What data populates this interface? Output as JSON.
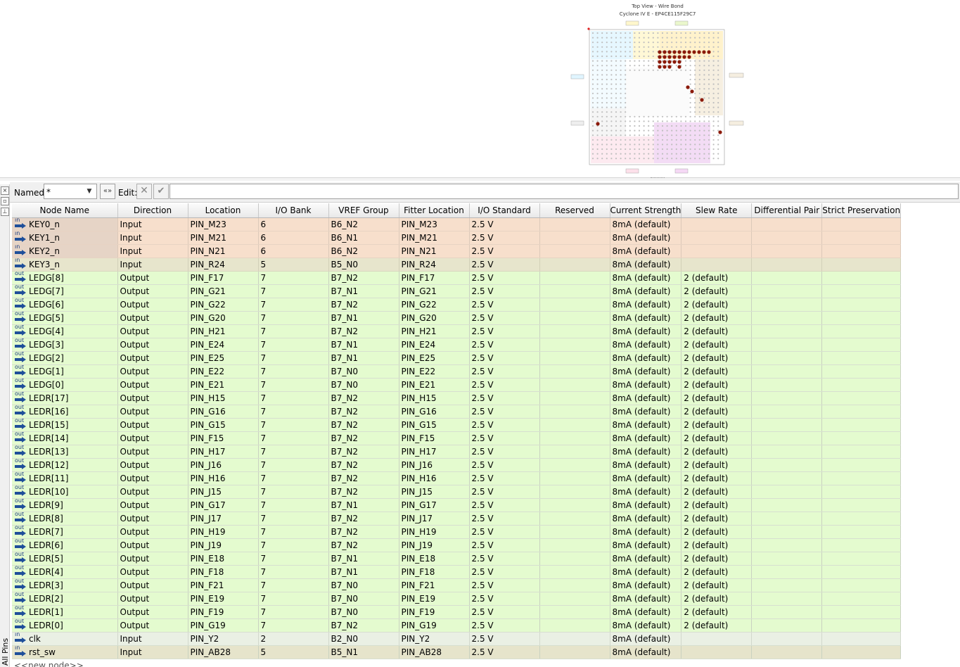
{
  "package_view": {
    "title": "Top View - Wire Bond",
    "device": "Cyclone IV E - EP4CE115F29C7"
  },
  "side_panel": {
    "label": "All Pins"
  },
  "filter": {
    "named_label": "Named:",
    "named_value": "*",
    "edit_label": "Edit:"
  },
  "columns": [
    "Node Name",
    "Direction",
    "Location",
    "I/O Bank",
    "VREF Group",
    "Fitter Location",
    "I/O Standard",
    "Reserved",
    "Current Strength",
    "Slew Rate",
    "Differential Pair",
    "Strict Preservation"
  ],
  "rows": [
    {
      "icon": "in",
      "name": "KEY0_n",
      "direction": "Input",
      "location": "PIN_M23",
      "bank": "6",
      "vref": "B6_N2",
      "fitter": "PIN_M23",
      "std": "2.5 V",
      "reserved": "",
      "current": "8mA (default)",
      "slew": "",
      "diff": "",
      "strict": ""
    },
    {
      "icon": "in",
      "name": "KEY1_n",
      "direction": "Input",
      "location": "PIN_M21",
      "bank": "6",
      "vref": "B6_N1",
      "fitter": "PIN_M21",
      "std": "2.5 V",
      "reserved": "",
      "current": "8mA (default)",
      "slew": "",
      "diff": "",
      "strict": ""
    },
    {
      "icon": "in",
      "name": "KEY2_n",
      "direction": "Input",
      "location": "PIN_N21",
      "bank": "6",
      "vref": "B6_N2",
      "fitter": "PIN_N21",
      "std": "2.5 V",
      "reserved": "",
      "current": "8mA (default)",
      "slew": "",
      "diff": "",
      "strict": ""
    },
    {
      "icon": "in",
      "name": "KEY3_n",
      "direction": "Input",
      "location": "PIN_R24",
      "bank": "5",
      "vref": "B5_N0",
      "fitter": "PIN_R24",
      "std": "2.5 V",
      "reserved": "",
      "current": "8mA (default)",
      "slew": "",
      "diff": "",
      "strict": ""
    },
    {
      "icon": "out",
      "name": "LEDG[8]",
      "direction": "Output",
      "location": "PIN_F17",
      "bank": "7",
      "vref": "B7_N2",
      "fitter": "PIN_F17",
      "std": "2.5 V",
      "reserved": "",
      "current": "8mA (default)",
      "slew": "2 (default)",
      "diff": "",
      "strict": ""
    },
    {
      "icon": "out",
      "name": "LEDG[7]",
      "direction": "Output",
      "location": "PIN_G21",
      "bank": "7",
      "vref": "B7_N1",
      "fitter": "PIN_G21",
      "std": "2.5 V",
      "reserved": "",
      "current": "8mA (default)",
      "slew": "2 (default)",
      "diff": "",
      "strict": ""
    },
    {
      "icon": "out",
      "name": "LEDG[6]",
      "direction": "Output",
      "location": "PIN_G22",
      "bank": "7",
      "vref": "B7_N2",
      "fitter": "PIN_G22",
      "std": "2.5 V",
      "reserved": "",
      "current": "8mA (default)",
      "slew": "2 (default)",
      "diff": "",
      "strict": ""
    },
    {
      "icon": "out",
      "name": "LEDG[5]",
      "direction": "Output",
      "location": "PIN_G20",
      "bank": "7",
      "vref": "B7_N1",
      "fitter": "PIN_G20",
      "std": "2.5 V",
      "reserved": "",
      "current": "8mA (default)",
      "slew": "2 (default)",
      "diff": "",
      "strict": ""
    },
    {
      "icon": "out",
      "name": "LEDG[4]",
      "direction": "Output",
      "location": "PIN_H21",
      "bank": "7",
      "vref": "B7_N2",
      "fitter": "PIN_H21",
      "std": "2.5 V",
      "reserved": "",
      "current": "8mA (default)",
      "slew": "2 (default)",
      "diff": "",
      "strict": ""
    },
    {
      "icon": "out",
      "name": "LEDG[3]",
      "direction": "Output",
      "location": "PIN_E24",
      "bank": "7",
      "vref": "B7_N1",
      "fitter": "PIN_E24",
      "std": "2.5 V",
      "reserved": "",
      "current": "8mA (default)",
      "slew": "2 (default)",
      "diff": "",
      "strict": ""
    },
    {
      "icon": "out",
      "name": "LEDG[2]",
      "direction": "Output",
      "location": "PIN_E25",
      "bank": "7",
      "vref": "B7_N1",
      "fitter": "PIN_E25",
      "std": "2.5 V",
      "reserved": "",
      "current": "8mA (default)",
      "slew": "2 (default)",
      "diff": "",
      "strict": ""
    },
    {
      "icon": "out",
      "name": "LEDG[1]",
      "direction": "Output",
      "location": "PIN_E22",
      "bank": "7",
      "vref": "B7_N0",
      "fitter": "PIN_E22",
      "std": "2.5 V",
      "reserved": "",
      "current": "8mA (default)",
      "slew": "2 (default)",
      "diff": "",
      "strict": ""
    },
    {
      "icon": "out",
      "name": "LEDG[0]",
      "direction": "Output",
      "location": "PIN_E21",
      "bank": "7",
      "vref": "B7_N0",
      "fitter": "PIN_E21",
      "std": "2.5 V",
      "reserved": "",
      "current": "8mA (default)",
      "slew": "2 (default)",
      "diff": "",
      "strict": ""
    },
    {
      "icon": "out",
      "name": "LEDR[17]",
      "direction": "Output",
      "location": "PIN_H15",
      "bank": "7",
      "vref": "B7_N2",
      "fitter": "PIN_H15",
      "std": "2.5 V",
      "reserved": "",
      "current": "8mA (default)",
      "slew": "2 (default)",
      "diff": "",
      "strict": ""
    },
    {
      "icon": "out",
      "name": "LEDR[16]",
      "direction": "Output",
      "location": "PIN_G16",
      "bank": "7",
      "vref": "B7_N2",
      "fitter": "PIN_G16",
      "std": "2.5 V",
      "reserved": "",
      "current": "8mA (default)",
      "slew": "2 (default)",
      "diff": "",
      "strict": ""
    },
    {
      "icon": "out",
      "name": "LEDR[15]",
      "direction": "Output",
      "location": "PIN_G15",
      "bank": "7",
      "vref": "B7_N2",
      "fitter": "PIN_G15",
      "std": "2.5 V",
      "reserved": "",
      "current": "8mA (default)",
      "slew": "2 (default)",
      "diff": "",
      "strict": ""
    },
    {
      "icon": "out",
      "name": "LEDR[14]",
      "direction": "Output",
      "location": "PIN_F15",
      "bank": "7",
      "vref": "B7_N2",
      "fitter": "PIN_F15",
      "std": "2.5 V",
      "reserved": "",
      "current": "8mA (default)",
      "slew": "2 (default)",
      "diff": "",
      "strict": ""
    },
    {
      "icon": "out",
      "name": "LEDR[13]",
      "direction": "Output",
      "location": "PIN_H17",
      "bank": "7",
      "vref": "B7_N2",
      "fitter": "PIN_H17",
      "std": "2.5 V",
      "reserved": "",
      "current": "8mA (default)",
      "slew": "2 (default)",
      "diff": "",
      "strict": ""
    },
    {
      "icon": "out",
      "name": "LEDR[12]",
      "direction": "Output",
      "location": "PIN_J16",
      "bank": "7",
      "vref": "B7_N2",
      "fitter": "PIN_J16",
      "std": "2.5 V",
      "reserved": "",
      "current": "8mA (default)",
      "slew": "2 (default)",
      "diff": "",
      "strict": ""
    },
    {
      "icon": "out",
      "name": "LEDR[11]",
      "direction": "Output",
      "location": "PIN_H16",
      "bank": "7",
      "vref": "B7_N2",
      "fitter": "PIN_H16",
      "std": "2.5 V",
      "reserved": "",
      "current": "8mA (default)",
      "slew": "2 (default)",
      "diff": "",
      "strict": ""
    },
    {
      "icon": "out",
      "name": "LEDR[10]",
      "direction": "Output",
      "location": "PIN_J15",
      "bank": "7",
      "vref": "B7_N2",
      "fitter": "PIN_J15",
      "std": "2.5 V",
      "reserved": "",
      "current": "8mA (default)",
      "slew": "2 (default)",
      "diff": "",
      "strict": ""
    },
    {
      "icon": "out",
      "name": "LEDR[9]",
      "direction": "Output",
      "location": "PIN_G17",
      "bank": "7",
      "vref": "B7_N1",
      "fitter": "PIN_G17",
      "std": "2.5 V",
      "reserved": "",
      "current": "8mA (default)",
      "slew": "2 (default)",
      "diff": "",
      "strict": ""
    },
    {
      "icon": "out",
      "name": "LEDR[8]",
      "direction": "Output",
      "location": "PIN_J17",
      "bank": "7",
      "vref": "B7_N2",
      "fitter": "PIN_J17",
      "std": "2.5 V",
      "reserved": "",
      "current": "8mA (default)",
      "slew": "2 (default)",
      "diff": "",
      "strict": ""
    },
    {
      "icon": "out",
      "name": "LEDR[7]",
      "direction": "Output",
      "location": "PIN_H19",
      "bank": "7",
      "vref": "B7_N2",
      "fitter": "PIN_H19",
      "std": "2.5 V",
      "reserved": "",
      "current": "8mA (default)",
      "slew": "2 (default)",
      "diff": "",
      "strict": ""
    },
    {
      "icon": "out",
      "name": "LEDR[6]",
      "direction": "Output",
      "location": "PIN_J19",
      "bank": "7",
      "vref": "B7_N2",
      "fitter": "PIN_J19",
      "std": "2.5 V",
      "reserved": "",
      "current": "8mA (default)",
      "slew": "2 (default)",
      "diff": "",
      "strict": ""
    },
    {
      "icon": "out",
      "name": "LEDR[5]",
      "direction": "Output",
      "location": "PIN_E18",
      "bank": "7",
      "vref": "B7_N1",
      "fitter": "PIN_E18",
      "std": "2.5 V",
      "reserved": "",
      "current": "8mA (default)",
      "slew": "2 (default)",
      "diff": "",
      "strict": ""
    },
    {
      "icon": "out",
      "name": "LEDR[4]",
      "direction": "Output",
      "location": "PIN_F18",
      "bank": "7",
      "vref": "B7_N1",
      "fitter": "PIN_F18",
      "std": "2.5 V",
      "reserved": "",
      "current": "8mA (default)",
      "slew": "2 (default)",
      "diff": "",
      "strict": ""
    },
    {
      "icon": "out",
      "name": "LEDR[3]",
      "direction": "Output",
      "location": "PIN_F21",
      "bank": "7",
      "vref": "B7_N0",
      "fitter": "PIN_F21",
      "std": "2.5 V",
      "reserved": "",
      "current": "8mA (default)",
      "slew": "2 (default)",
      "diff": "",
      "strict": ""
    },
    {
      "icon": "out",
      "name": "LEDR[2]",
      "direction": "Output",
      "location": "PIN_E19",
      "bank": "7",
      "vref": "B7_N0",
      "fitter": "PIN_E19",
      "std": "2.5 V",
      "reserved": "",
      "current": "8mA (default)",
      "slew": "2 (default)",
      "diff": "",
      "strict": ""
    },
    {
      "icon": "out",
      "name": "LEDR[1]",
      "direction": "Output",
      "location": "PIN_F19",
      "bank": "7",
      "vref": "B7_N0",
      "fitter": "PIN_F19",
      "std": "2.5 V",
      "reserved": "",
      "current": "8mA (default)",
      "slew": "2 (default)",
      "diff": "",
      "strict": ""
    },
    {
      "icon": "out",
      "name": "LEDR[0]",
      "direction": "Output",
      "location": "PIN_G19",
      "bank": "7",
      "vref": "B7_N2",
      "fitter": "PIN_G19",
      "std": "2.5 V",
      "reserved": "",
      "current": "8mA (default)",
      "slew": "2 (default)",
      "diff": "",
      "strict": ""
    },
    {
      "icon": "in",
      "name": "clk",
      "direction": "Input",
      "location": "PIN_Y2",
      "bank": "2",
      "vref": "B2_N0",
      "fitter": "PIN_Y2",
      "std": "2.5 V",
      "reserved": "",
      "current": "8mA (default)",
      "slew": "",
      "diff": "",
      "strict": ""
    },
    {
      "icon": "in",
      "name": "rst_sw",
      "direction": "Input",
      "location": "PIN_AB28",
      "bank": "5",
      "vref": "B5_N1",
      "fitter": "PIN_AB28",
      "std": "2.5 V",
      "reserved": "",
      "current": "8mA (default)",
      "slew": "",
      "diff": "",
      "strict": ""
    }
  ],
  "new_node_text": "<<new node>>",
  "colors": {
    "input_row": "#f7dfcc",
    "output_row": "#e4fbcf",
    "pin_marker": "#8b1a0a"
  }
}
